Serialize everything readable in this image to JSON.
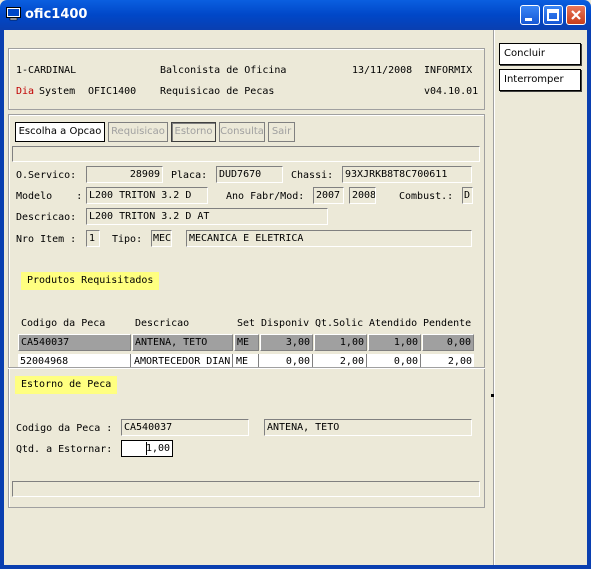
{
  "window": {
    "title": "ofic1400"
  },
  "side_buttons": {
    "concluir": "Concluir",
    "interromper": "Interromper"
  },
  "header": {
    "company": "1-CARDINAL",
    "role": "Balconista de Oficina",
    "date": "13/11/2008",
    "db": "INFORMIX",
    "brand_a": "Dia",
    "brand_b": "System",
    "program": "OFIC1400",
    "screen": "Requisicao de Pecas",
    "version": "v04.10.01"
  },
  "tabs": [
    "Escolha a Opcao",
    "Requisicao",
    "Estorno",
    "Consulta",
    "Sair"
  ],
  "service": {
    "os_label": "O.Servico:",
    "os_value": "28909",
    "placa_label": "Placa:",
    "placa_value": "DUD7670",
    "chassi_label": "Chassi:",
    "chassi_value": "93XJRKB8T8C700611",
    "modelo_label": "Modelo    :",
    "modelo_value": "L200 TRITON 3.2 D",
    "ano_label": "Ano Fabr/Mod:",
    "ano_fabr": "2007",
    "ano_mod": "2008",
    "comb_label": "Combust.:",
    "comb_value": "D",
    "descr_label": "Descricao:",
    "descr_value": "L200 TRITON 3.2 D AT",
    "item_label": "Nro Item :",
    "item_value": "1",
    "tipo_label": "Tipo:",
    "tipo_code": "MEC",
    "tipo_desc": "MECANICA E ELETRICA"
  },
  "produtos": {
    "title": "Produtos Requisitados",
    "columns": [
      "Codigo da Peca",
      "Descricao",
      "Set",
      "Disponiv",
      "Qt.Solic",
      "Atendido",
      "Pendente"
    ],
    "rows": [
      [
        "CA540037",
        "ANTENA, TETO",
        "ME",
        "3,00",
        "1,00",
        "1,00",
        "0,00"
      ],
      [
        "52004968",
        "AMORTECEDOR DIAN",
        "ME",
        "0,00",
        "2,00",
        "0,00",
        "2,00"
      ]
    ]
  },
  "estorno": {
    "title": "Estorno de Peca",
    "codigo_label": "Codigo da Peca :",
    "codigo_value": "CA540037",
    "codigo_desc": "ANTENA, TETO",
    "qtd_label": "Qtd. a Estornar:",
    "qtd_value": "1,00"
  },
  "colors": {
    "titlebar": "#0a5fe0",
    "highlight": "#ffff80",
    "brand_red": "#c00000",
    "selected_row": "#a0a0a0"
  }
}
